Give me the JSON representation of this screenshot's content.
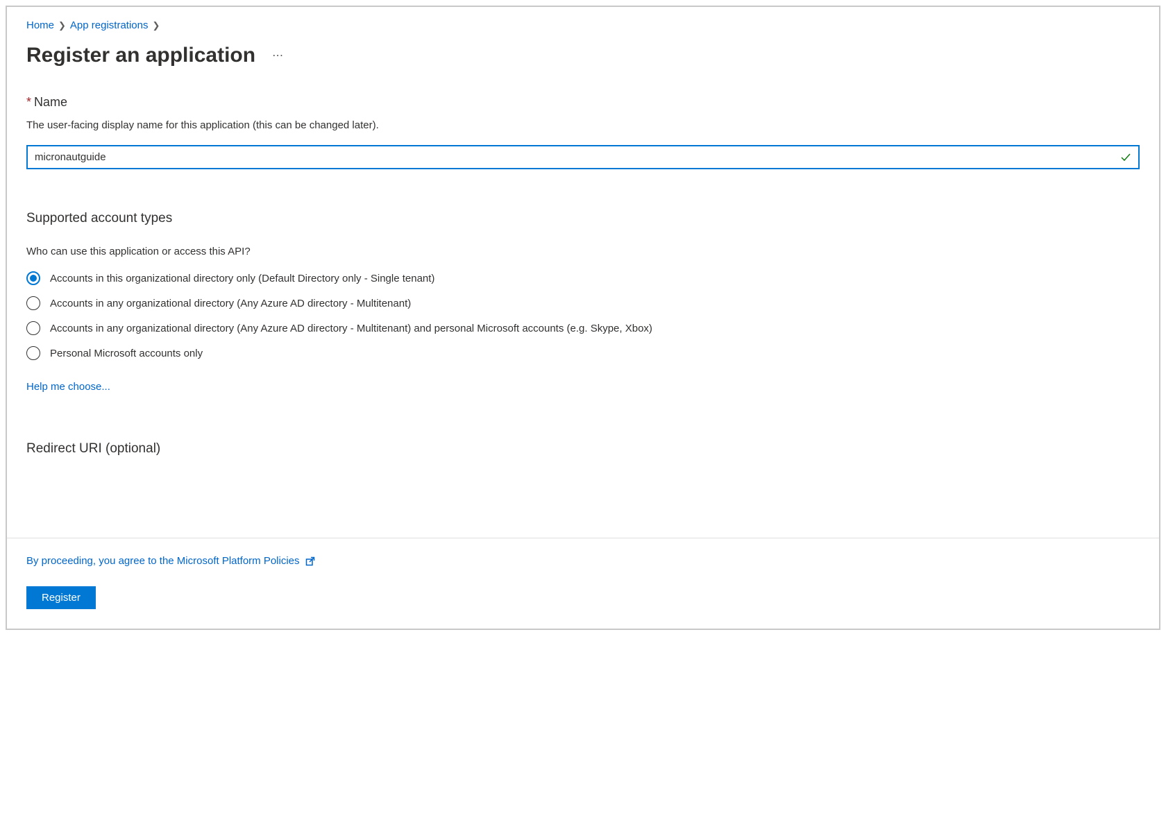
{
  "breadcrumb": {
    "items": [
      "Home",
      "App registrations"
    ]
  },
  "page": {
    "title": "Register an application"
  },
  "name_field": {
    "label": "Name",
    "description": "The user-facing display name for this application (this can be changed later).",
    "value": "micronautguide"
  },
  "account_types": {
    "heading": "Supported account types",
    "question": "Who can use this application or access this API?",
    "options": [
      "Accounts in this organizational directory only (Default Directory only - Single tenant)",
      "Accounts in any organizational directory (Any Azure AD directory - Multitenant)",
      "Accounts in any organizational directory (Any Azure AD directory - Multitenant) and personal Microsoft accounts (e.g. Skype, Xbox)",
      "Personal Microsoft accounts only"
    ],
    "selected_index": 0,
    "help_link": "Help me choose..."
  },
  "redirect_uri": {
    "heading": "Redirect URI (optional)"
  },
  "footer": {
    "policies_text": "By proceeding, you agree to the Microsoft Platform Policies",
    "register_button": "Register"
  }
}
